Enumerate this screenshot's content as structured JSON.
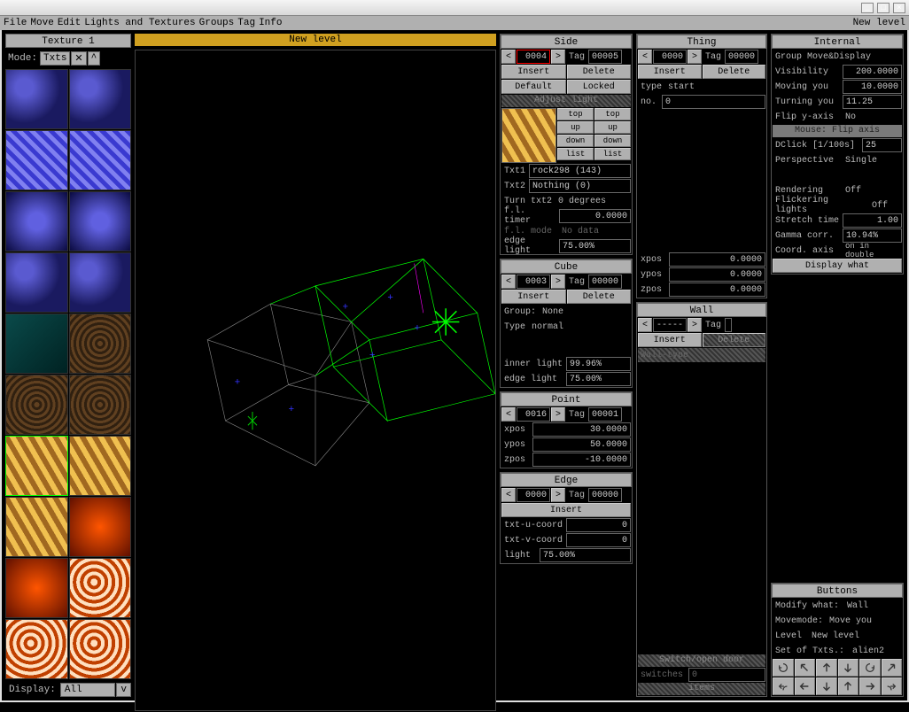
{
  "menubar": {
    "items": [
      "File",
      "Move",
      "Edit",
      "Lights and Textures",
      "Groups",
      "Tag",
      "Info"
    ],
    "right": "New level"
  },
  "window_controls": [
    "_",
    "□",
    "×"
  ],
  "textures": {
    "header": "Texture 1",
    "mode_label": "Mode:",
    "mode_value": "Txts",
    "mode_lock": "✕",
    "display_label": "Display:",
    "display_value": "All"
  },
  "view": {
    "title": "New level"
  },
  "side": {
    "title": "Side",
    "id": "0004",
    "tag_label": "Tag",
    "tag": "00005",
    "insert": "Insert",
    "delete": "Delete",
    "default": "Default",
    "locked": "Locked",
    "adjust": "Adjust light",
    "tex_btns": [
      [
        "top",
        "top"
      ],
      [
        "up",
        "up"
      ],
      [
        "down",
        "down"
      ],
      [
        "list",
        "list"
      ]
    ],
    "txt1_label": "Txt1",
    "txt1": "rock298 (143)",
    "txt2_label": "Txt2",
    "txt2": "Nothing (0)",
    "turn_label": "Turn txt2",
    "turn": "0 degrees",
    "timer_label": "f.l. timer",
    "timer": "0.0000",
    "mode_label": "f.l. mode",
    "mode": "No data",
    "edge_label": "edge light",
    "edge": "75.00%"
  },
  "cube": {
    "title": "Cube",
    "id": "0003",
    "tag_label": "Tag",
    "tag": "00000",
    "insert": "Insert",
    "delete": "Delete",
    "group_label": "Group:",
    "group": "None",
    "type_label": "Type",
    "type": "normal",
    "inner_label": "inner light",
    "inner": "99.96%",
    "edge_label": "edge light",
    "edge": "75.00%"
  },
  "point": {
    "title": "Point",
    "id": "0016",
    "tag_label": "Tag",
    "tag": "00001",
    "xpos_label": "xpos",
    "xpos": "30.0000",
    "ypos_label": "ypos",
    "ypos": "50.0000",
    "zpos_label": "zpos",
    "zpos": "-10.0000"
  },
  "edge": {
    "title": "Edge",
    "id": "0000",
    "tag_label": "Tag",
    "tag": "00000",
    "insert": "Insert",
    "u_label": "txt-u-coord",
    "u": "0",
    "v_label": "txt-v-coord",
    "v": "0",
    "light_label": "light",
    "light": "75.00%"
  },
  "thing": {
    "title": "Thing",
    "id": "0000",
    "tag_label": "Tag",
    "tag": "00000",
    "insert": "Insert",
    "delete": "Delete",
    "type_label": "type",
    "type": "start",
    "no_label": "no.",
    "no": "0",
    "xpos_label": "xpos",
    "xpos": "0.0000",
    "ypos_label": "ypos",
    "ypos": "0.0000",
    "zpos_label": "zpos",
    "zpos": "0.0000"
  },
  "wall": {
    "title": "Wall",
    "id": "-----",
    "tag_label": "Tag",
    "tag": "",
    "insert": "Insert",
    "delete": "Delete",
    "type_label": "Wall-type",
    "switch_label": "Switch/open door",
    "switches_label": "switches",
    "switches": "0",
    "items": "items"
  },
  "internal": {
    "title": "Internal",
    "group_label": "Group Move&Display",
    "visibility_label": "Visibility",
    "visibility": "200.0000",
    "moving_label": "Moving you",
    "moving": "10.0000",
    "turning_label": "Turning you",
    "turning": "11.25",
    "flip_label": "Flip y-axis",
    "flip": "No",
    "mouse_label": "Mouse: Flip axis",
    "dclick_label": "DClick [1/100s]",
    "dclick": "25",
    "persp_label": "Perspective",
    "persp": "Single",
    "rendering_label": "Rendering",
    "rendering": "Off",
    "flicker_label": "Flickering lights",
    "flicker": "Off",
    "stretch_label": "Stretch time",
    "stretch": "1.00",
    "gamma_label": "Gamma corr.",
    "gamma": "10.94%",
    "coord_label": "Coord. axis",
    "coord": "on in double",
    "display_what": "Display what"
  },
  "buttons": {
    "title": "Buttons",
    "modify_label": "Modify what:",
    "modify": "Wall",
    "movemode_label": "Movemode:",
    "movemode": "Move you",
    "level_label": "Level",
    "level": "New level",
    "txtset_label": "Set of Txts.:",
    "txtset": "alien2"
  }
}
